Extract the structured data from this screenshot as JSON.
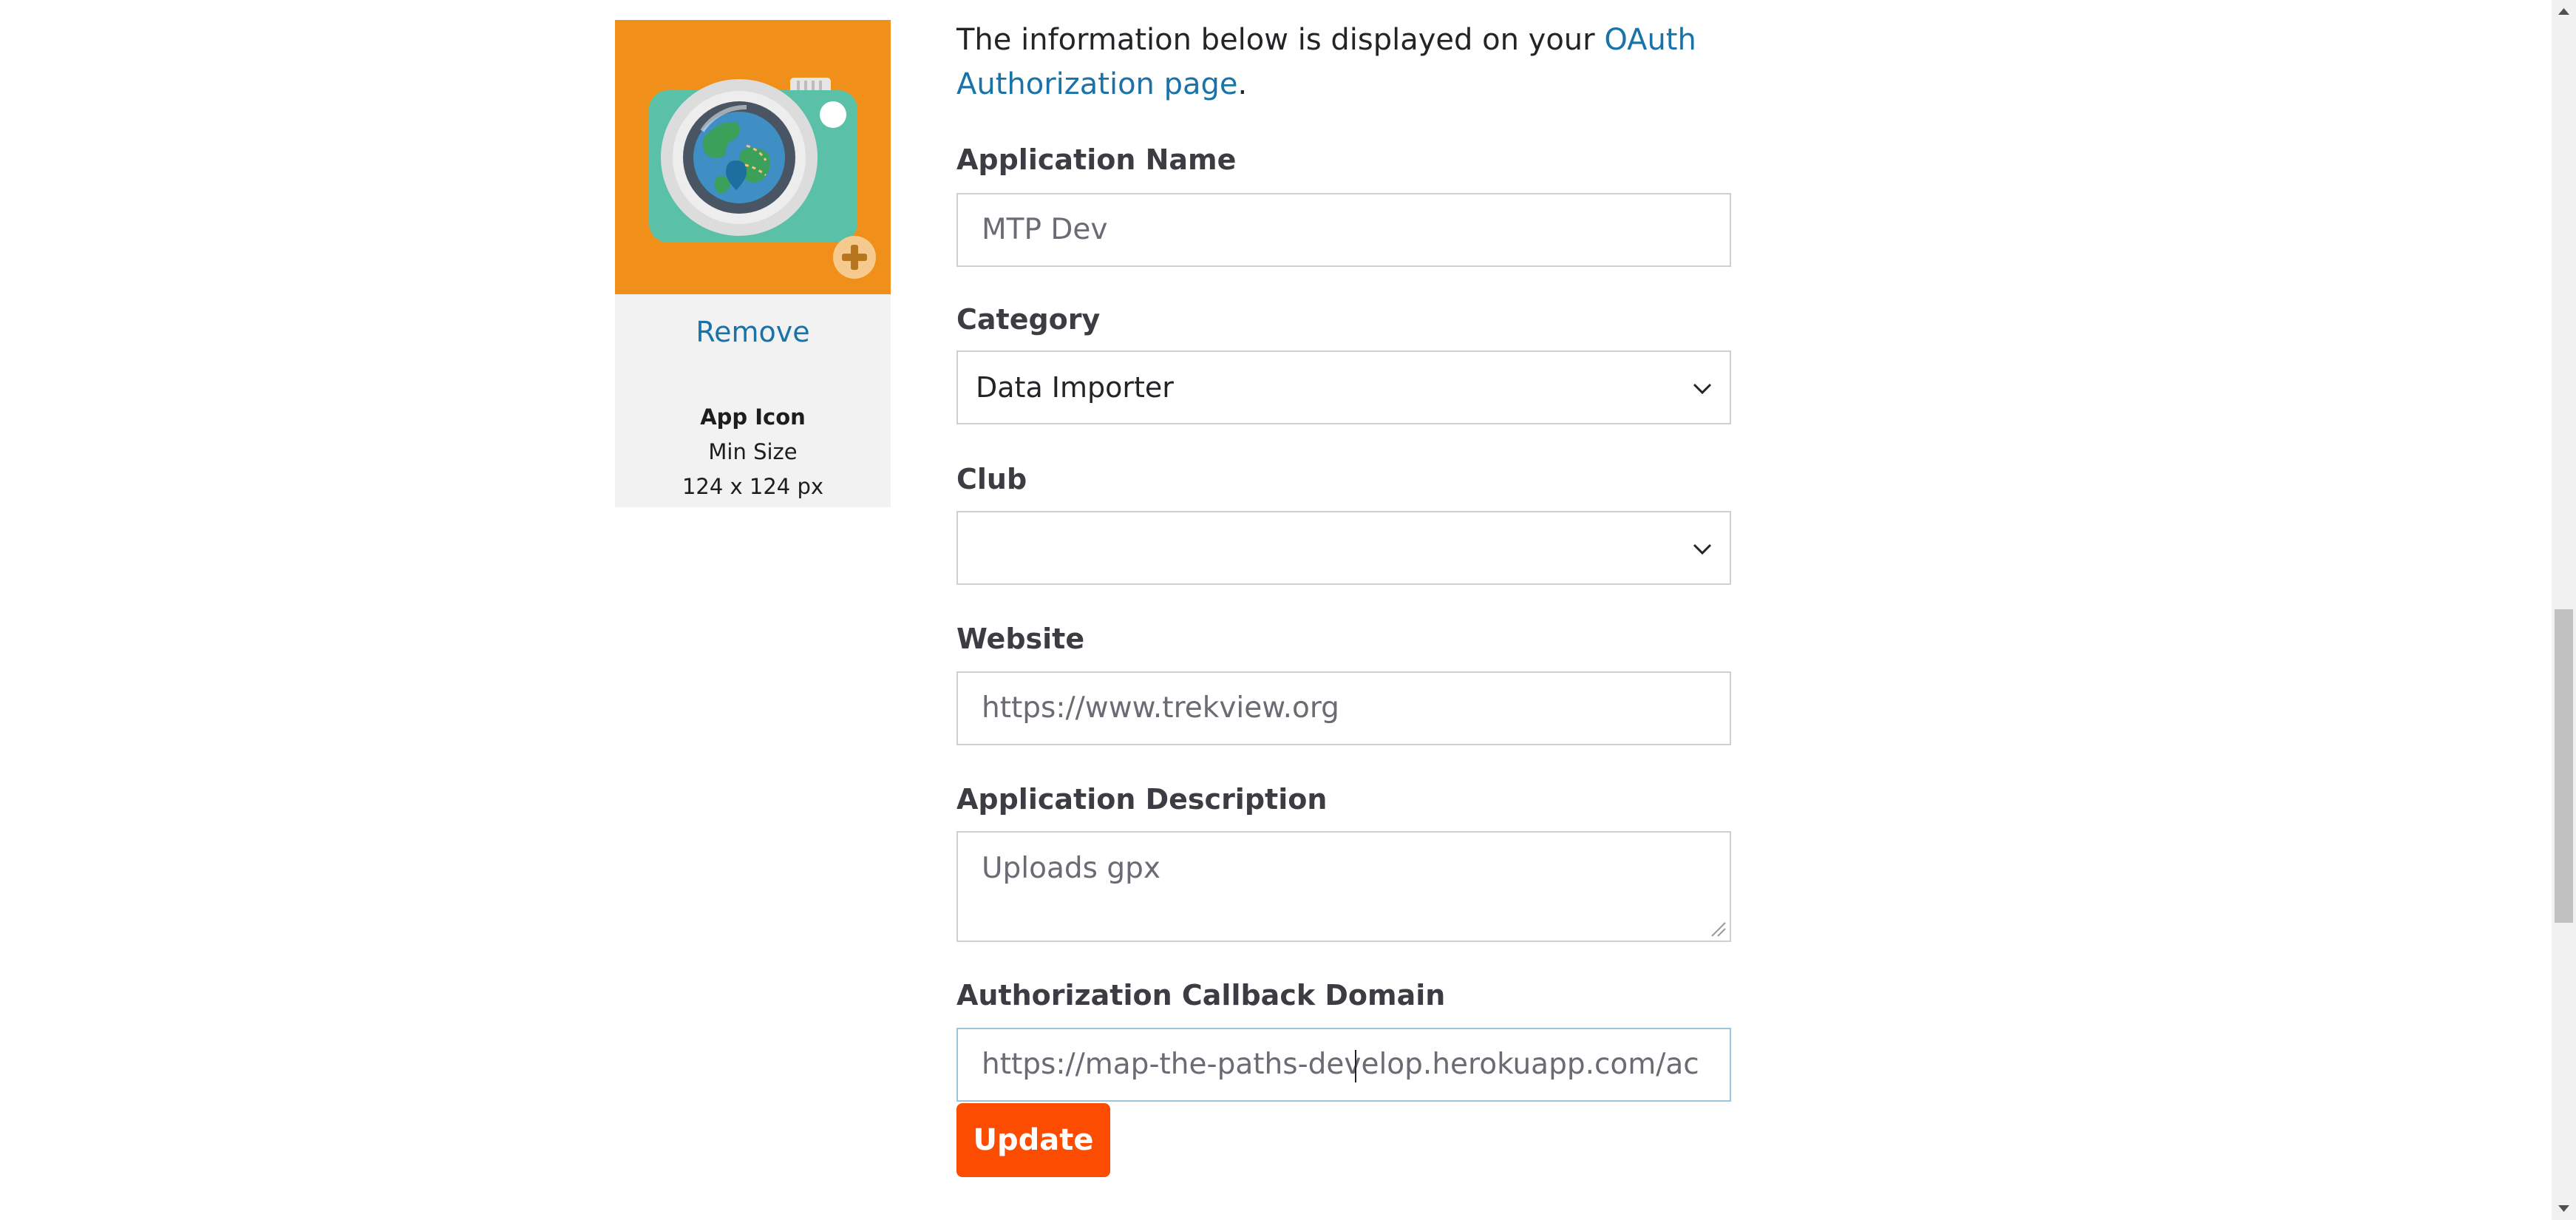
{
  "app_icon": {
    "remove_label": "Remove",
    "title": "App Icon",
    "min_size_label": "Min Size",
    "size": "124 x 124 px",
    "background_color": "#f0901a"
  },
  "intro": {
    "text": "The information below is displayed on your ",
    "link": "OAuth Authorization page",
    "suffix": "."
  },
  "form": {
    "application_name": {
      "label": "Application Name",
      "value": "MTP Dev"
    },
    "category": {
      "label": "Category",
      "value": "Data Importer"
    },
    "club": {
      "label": "Club",
      "value": ""
    },
    "website": {
      "label": "Website",
      "value": "https://www.trekview.org"
    },
    "description": {
      "label": "Application Description",
      "value": "Uploads gpx"
    },
    "callback_domain": {
      "label": "Authorization Callback Domain",
      "value": "https://map-the-paths-develop.herokuapp.com/ac"
    },
    "update_label": "Update"
  },
  "colors": {
    "accent": "#fc4c02",
    "link": "#1a73a8"
  }
}
